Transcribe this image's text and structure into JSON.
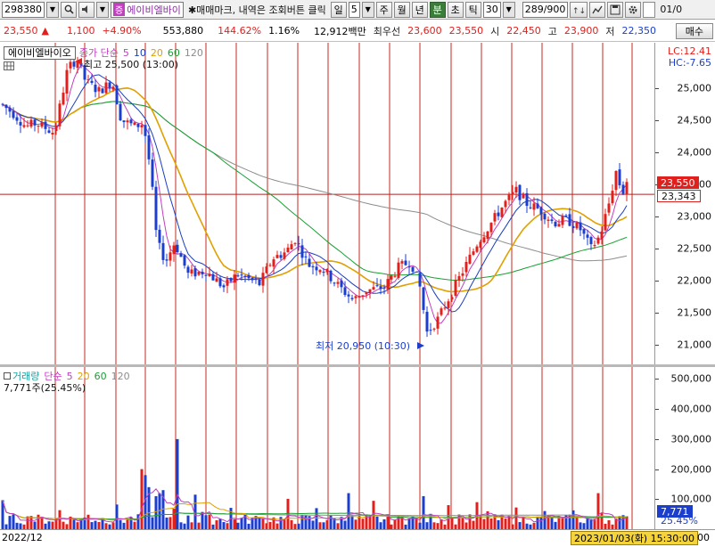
{
  "toolbar": {
    "code": "298380",
    "stock_name": "에이비엘바이",
    "marker_note": "✱매매마크, 내역은 조회버튼 클릭",
    "period_label": "일",
    "period_value": "5",
    "week": "주",
    "month": "월",
    "year": "년",
    "minute": "분",
    "second": "초",
    "tick": "틱",
    "tick_value": "30",
    "page_count": "289/900",
    "date_cut": "01/0"
  },
  "info": {
    "price": "23,550",
    "change": "1,100",
    "change_pct": "+4.90%",
    "volume": "553,880",
    "volume_ratio": "144.62%",
    "turnover_rate": "1.16%",
    "amount": "12,912백만",
    "best_label": "최우선",
    "best_ask": "23,600",
    "best_bid": "23,550",
    "open_label": "시",
    "open": "22,450",
    "high_label": "고",
    "high": "23,900",
    "low_label": "저",
    "low": "22,350",
    "sell_button": "매수"
  },
  "price_legend": {
    "name": "에이비엘바이오",
    "kind": "종가 단순",
    "ma": [
      "5",
      "10",
      "20",
      "60",
      "120"
    ],
    "ma_colors": [
      "#c040c0",
      "#1a3fc0",
      "#e0a000",
      "#18a030",
      "#8c8c8c"
    ]
  },
  "price_annotations": {
    "high_text": "최고 25,500 (13:00)",
    "low_text": "최저 20,950 (10:30)"
  },
  "price_axis": {
    "lc": "LC:12.41",
    "hc": "HC:-7.65",
    "ticks": [
      "25,000",
      "24,500",
      "24,000",
      "23,500",
      "23,000",
      "22,500",
      "22,000",
      "21,500",
      "21,000"
    ],
    "current_tag": "23,550",
    "ref_tag": "23,343"
  },
  "volume_legend": {
    "name": "거래량",
    "kind": "단순",
    "ma": [
      "5",
      "20",
      "60",
      "120"
    ],
    "current": "7,771주(25.45%)"
  },
  "volume_axis": {
    "ticks": [
      "500,000",
      "400,000",
      "300,000",
      "200,000",
      "100,000"
    ],
    "current_tag": "7,771",
    "pct_tag": "25.45%"
  },
  "date_axis": {
    "start": "2022/12",
    "cursor": "2023/01/03(화) 15:30:00",
    "end_cut": "00"
  },
  "colors": {
    "up": "#e0201c",
    "down": "#1b3fcc",
    "grid_day": "#c8281e",
    "ma5": "#c040c0",
    "ma10": "#1a3fc0",
    "ma20": "#e0a000",
    "ma60": "#18a030",
    "ma120": "#8c8c8c"
  },
  "chart_data": {
    "type": "candlestick",
    "interval_minutes": 5,
    "price_range": [
      20700,
      25700
    ],
    "volume_range": [
      0,
      540000
    ],
    "highlight_high": 25500,
    "highlight_low": 20950,
    "current_price": 23550,
    "reference_line": 23343
  }
}
